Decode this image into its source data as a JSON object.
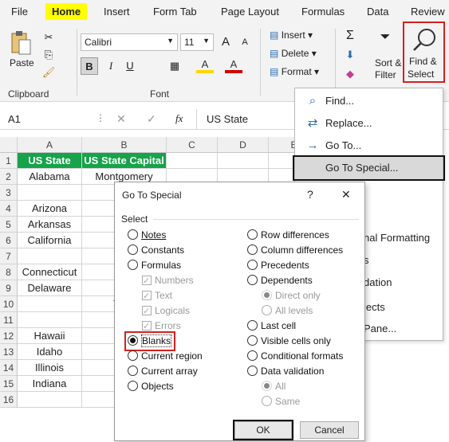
{
  "ribbon_tabs": [
    "File",
    "Home",
    "Insert",
    "Form Tab",
    "Page Layout",
    "Formulas",
    "Data",
    "Review"
  ],
  "clipboard": {
    "paste": "Paste",
    "group": "Clipboard"
  },
  "font": {
    "name": "Calibri",
    "size": "11",
    "bold": "B",
    "italic": "I",
    "underline": "U",
    "grow": "A",
    "shrink": "A",
    "fill": "A",
    "color": "A",
    "group": "Font"
  },
  "cells_group": {
    "insert": "Insert",
    "delete": "Delete",
    "format": "Format"
  },
  "editing": {
    "sort_line1": "Sort &",
    "sort_line2": "Filter",
    "find_line1": "Find &",
    "find_line2": "Select"
  },
  "formula_bar": {
    "name_box": "A1",
    "fx": "fx",
    "value": "US State"
  },
  "columns": [
    "A",
    "B",
    "C",
    "D",
    "E"
  ],
  "rows": [
    "1",
    "2",
    "3",
    "4",
    "5",
    "6",
    "7",
    "8",
    "9",
    "10",
    "11",
    "12",
    "13",
    "14",
    "15",
    "16"
  ],
  "header_row": {
    "a": "US State",
    "b": "US State Capital"
  },
  "col_a": [
    "Alabama",
    "",
    "Arizona",
    "Arkansas",
    "California",
    "",
    "Connecticut",
    "Delaware",
    "",
    "",
    "Hawaii",
    "Idaho",
    "Illinois",
    "Indiana",
    ""
  ],
  "col_b_partial": [
    "Montgomery",
    "Ju",
    "Ph",
    "",
    "Sacr",
    "",
    "Ha",
    "",
    "Talla",
    "At",
    "",
    "B",
    "",
    "",
    ""
  ],
  "menu": {
    "items": [
      {
        "icon": "⌕",
        "label": "Find..."
      },
      {
        "icon": "⇄",
        "label": "Replace..."
      },
      {
        "icon": "→",
        "label": "Go To..."
      },
      {
        "icon": "",
        "label": "Go To Special..."
      }
    ],
    "partial_items": [
      "nal Formatting",
      "s",
      "dation",
      "jects",
      "Pane..."
    ]
  },
  "dialog": {
    "title": "Go To Special",
    "help": "?",
    "close": "✕",
    "section": "Select",
    "left": {
      "notes": "Notes",
      "constants": "Constants",
      "formulas": "Formulas",
      "numbers": "Numbers",
      "text": "Text",
      "logicals": "Logicals",
      "errors": "Errors",
      "blanks": "Blanks",
      "current_region": "Current region",
      "current_array": "Current array",
      "objects": "Objects"
    },
    "right": {
      "row_diff": "Row differences",
      "col_diff": "Column differences",
      "precedents": "Precedents",
      "dependents": "Dependents",
      "direct_only": "Direct only",
      "all_levels": "All levels",
      "last_cell": "Last cell",
      "visible_only": "Visible cells only",
      "cond_formats": "Conditional formats",
      "data_validation": "Data validation",
      "all": "All",
      "same": "Same"
    },
    "ok": "OK",
    "cancel": "Cancel"
  },
  "colors": {
    "header_green": "#16a34a",
    "highlight_yellow": "#ffff00",
    "callout_red": "#d42020"
  }
}
